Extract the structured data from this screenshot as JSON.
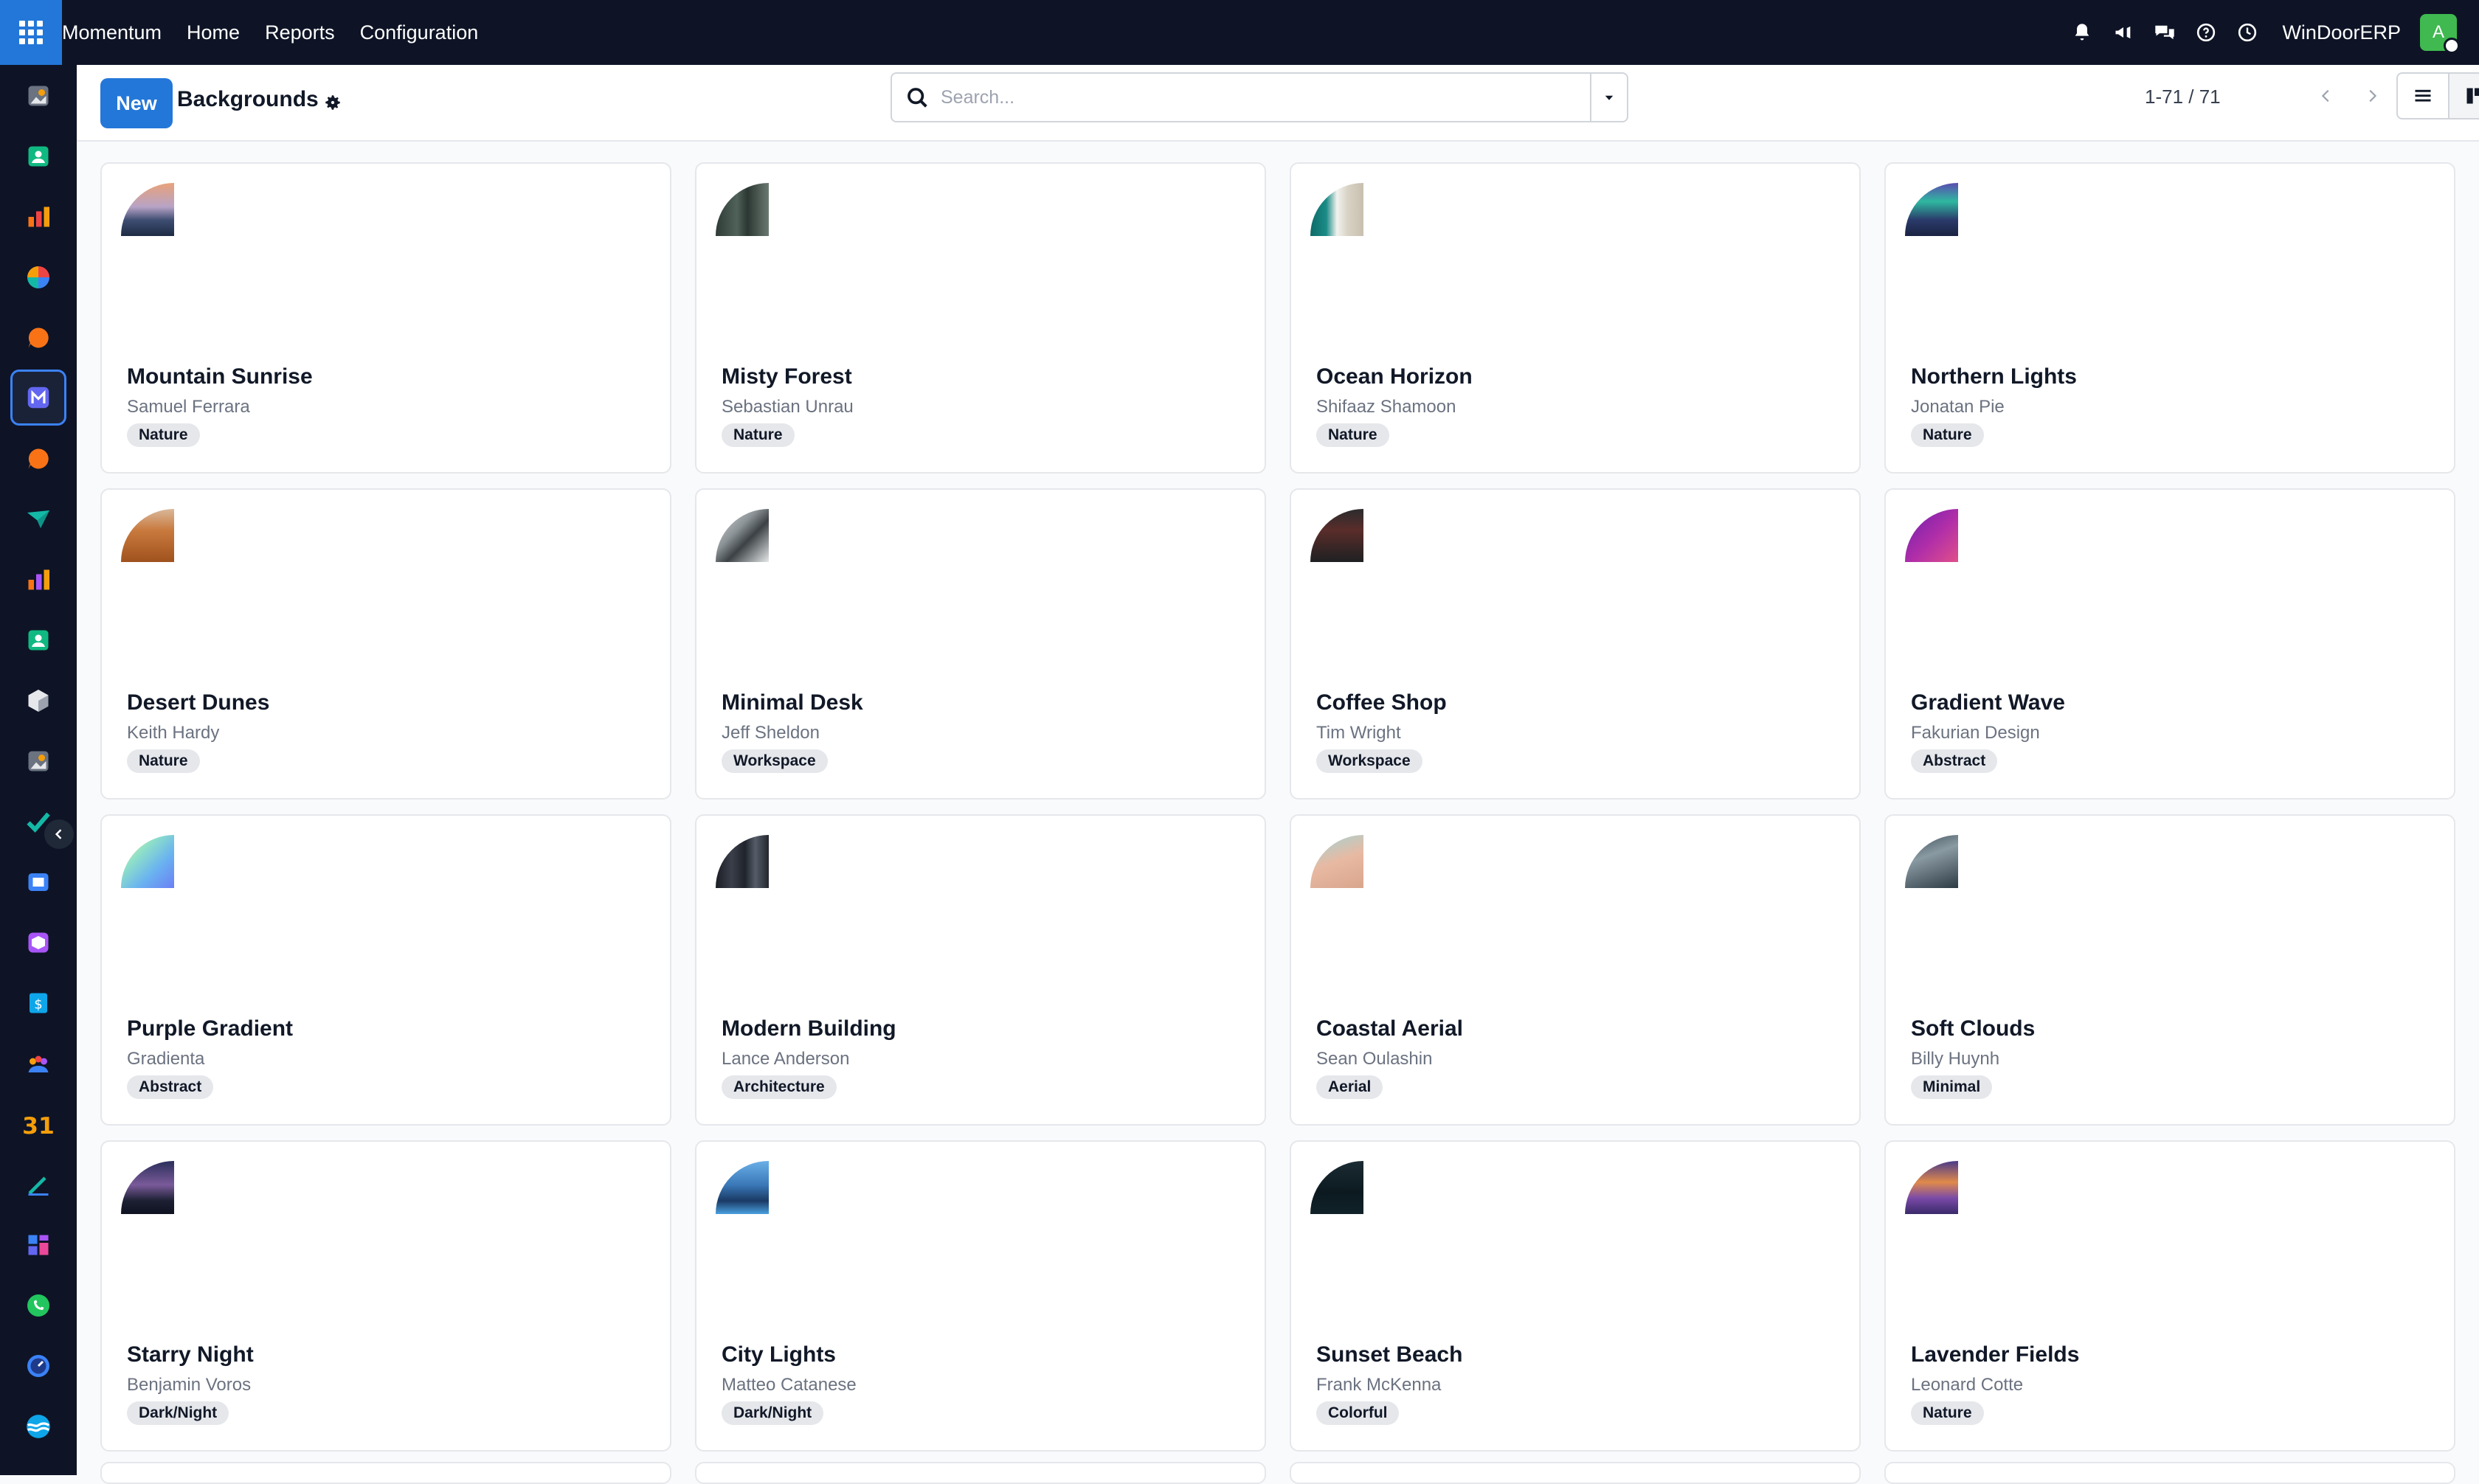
{
  "topbar": {
    "brand": "Momentum",
    "nav": [
      "Home",
      "Reports",
      "Configuration"
    ],
    "company": "WinDoorERP",
    "avatar_letter": "A"
  },
  "controls": {
    "new_label": "New",
    "title": "Backgrounds",
    "search_placeholder": "Search...",
    "pager": "1-71 / 71"
  },
  "cards": [
    {
      "title": "Mountain Sunrise",
      "author": "Samuel Ferrara",
      "tag": "Nature"
    },
    {
      "title": "Misty Forest",
      "author": "Sebastian Unrau",
      "tag": "Nature"
    },
    {
      "title": "Ocean Horizon",
      "author": "Shifaaz Shamoon",
      "tag": "Nature"
    },
    {
      "title": "Northern Lights",
      "author": "Jonatan Pie",
      "tag": "Nature"
    },
    {
      "title": "Desert Dunes",
      "author": "Keith Hardy",
      "tag": "Nature"
    },
    {
      "title": "Minimal Desk",
      "author": "Jeff Sheldon",
      "tag": "Workspace"
    },
    {
      "title": "Coffee Shop",
      "author": "Tim Wright",
      "tag": "Workspace"
    },
    {
      "title": "Gradient Wave",
      "author": "Fakurian Design",
      "tag": "Abstract"
    },
    {
      "title": "Purple Gradient",
      "author": "Gradienta",
      "tag": "Abstract"
    },
    {
      "title": "Modern Building",
      "author": "Lance Anderson",
      "tag": "Architecture"
    },
    {
      "title": "Coastal Aerial",
      "author": "Sean Oulashin",
      "tag": "Aerial"
    },
    {
      "title": "Soft Clouds",
      "author": "Billy Huynh",
      "tag": "Minimal"
    },
    {
      "title": "Starry Night",
      "author": "Benjamin Voros",
      "tag": "Dark/Night"
    },
    {
      "title": "City Lights",
      "author": "Matteo Catanese",
      "tag": "Dark/Night"
    },
    {
      "title": "Sunset Beach",
      "author": "Frank McKenna",
      "tag": "Colorful"
    },
    {
      "title": "Lavender Fields",
      "author": "Leonard Cotte",
      "tag": "Nature"
    }
  ],
  "colors": {
    "topbar_bg": "#0e1426",
    "accent": "#2377d8",
    "tag_bg": "#e5e7eb"
  }
}
